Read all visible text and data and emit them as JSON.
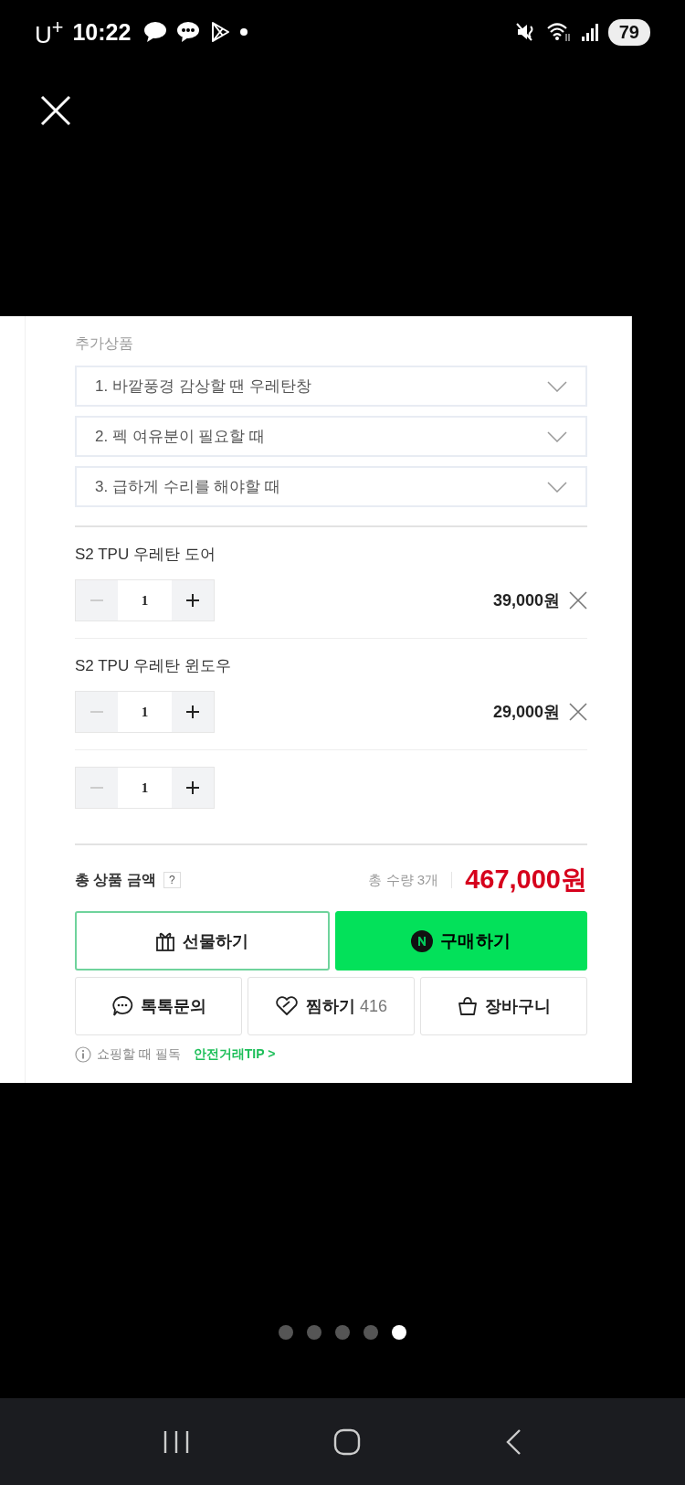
{
  "status_bar": {
    "carrier": "U$^{+}$",
    "time": "10:22",
    "battery": "79"
  },
  "section_title": "추가상품",
  "add_on_selects": [
    {
      "label": "1. 바깥풍경 감상할 땐 우레탄창"
    },
    {
      "label": "2. 펙 여유분이 필요할 때"
    },
    {
      "label": "3. 급하게 수리를 해야할 때"
    }
  ],
  "items": [
    {
      "name": "S2 TPU 우레탄 도어",
      "quantity": "1",
      "price": "39,000원"
    },
    {
      "name": "S2 TPU 우레탄 윈도우",
      "quantity": "1",
      "price": "29,000원"
    },
    {
      "quantity": "1"
    }
  ],
  "total": {
    "label": "총 상품 금액",
    "help": "?",
    "count": "총 수량 3개",
    "amount": "467,000원"
  },
  "buttons": {
    "gift": "선물하기",
    "buy": "구매하기",
    "talk": "톡톡문의",
    "wish": "찜하기",
    "wish_count": "416",
    "cart": "장바구니"
  },
  "tip": {
    "text": "쇼핑할 때 필독",
    "link": "안전거래TIP >"
  },
  "page_dots": [
    {
      "selected": false
    },
    {
      "selected": false
    },
    {
      "selected": false
    },
    {
      "selected": false
    },
    {
      "selected": true
    }
  ]
}
